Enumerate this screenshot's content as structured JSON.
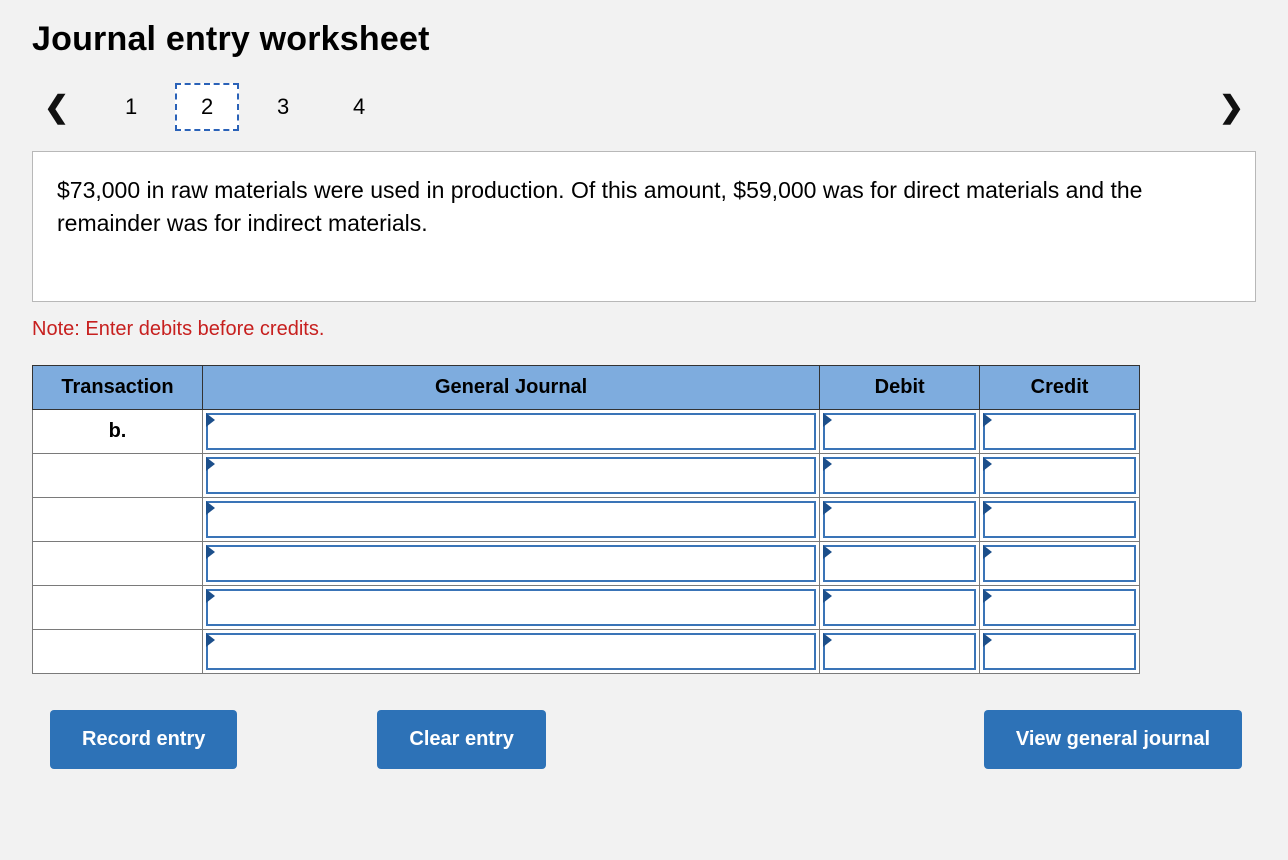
{
  "title": "Journal entry worksheet",
  "nav": {
    "prev": "‹",
    "next": "›",
    "tabs": [
      "1",
      "2",
      "3",
      "4"
    ],
    "active_index": 1
  },
  "prompt": "$73,000 in raw materials were used in production. Of this amount, $59,000 was for direct materials and the remainder was for indirect materials.",
  "note": "Note: Enter debits before credits.",
  "table": {
    "headers": {
      "transaction": "Transaction",
      "general_journal": "General Journal",
      "debit": "Debit",
      "credit": "Credit"
    },
    "transaction_label": "b.",
    "rows": [
      {
        "transaction": "b.",
        "general_journal": "",
        "debit": "",
        "credit": ""
      },
      {
        "transaction": "",
        "general_journal": "",
        "debit": "",
        "credit": ""
      },
      {
        "transaction": "",
        "general_journal": "",
        "debit": "",
        "credit": ""
      },
      {
        "transaction": "",
        "general_journal": "",
        "debit": "",
        "credit": ""
      },
      {
        "transaction": "",
        "general_journal": "",
        "debit": "",
        "credit": ""
      },
      {
        "transaction": "",
        "general_journal": "",
        "debit": "",
        "credit": ""
      }
    ]
  },
  "buttons": {
    "record": "Record entry",
    "clear": "Clear entry",
    "view": "View general journal"
  }
}
